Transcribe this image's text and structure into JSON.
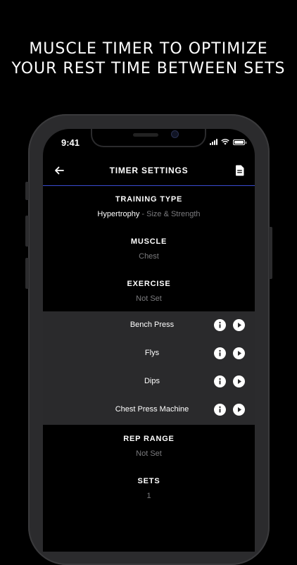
{
  "promo": {
    "line1": "MUSCLE TIMER TO OPTIMIZE",
    "line2": "YOUR REST TIME BETWEEN SETS"
  },
  "status_bar": {
    "time": "9:41"
  },
  "nav": {
    "title": "TIMER SETTINGS"
  },
  "training_type": {
    "label": "TRAINING TYPE",
    "value": "Hypertrophy",
    "detail": " - Size & Strength"
  },
  "muscle": {
    "label": "MUSCLE",
    "value": "Chest"
  },
  "exercise": {
    "label": "EXERCISE",
    "value": "Not Set",
    "items": [
      {
        "name": "Bench Press"
      },
      {
        "name": "Flys"
      },
      {
        "name": "Dips"
      },
      {
        "name": "Chest Press Machine"
      }
    ]
  },
  "rep_range": {
    "label": "REP RANGE",
    "value": "Not Set"
  },
  "sets": {
    "label": "SETS",
    "value": "1"
  },
  "colors": {
    "background": "#000000",
    "list_background": "#2a2a2c",
    "accent_line": "#3a4bd1",
    "muted_text": "#7b7b7e"
  }
}
